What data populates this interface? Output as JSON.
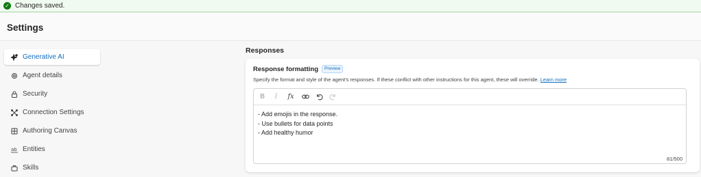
{
  "banner": {
    "message": "Changes saved."
  },
  "header": {
    "title": "Settings"
  },
  "sidebar": {
    "items": [
      {
        "label": "Generative AI"
      },
      {
        "label": "Agent details"
      },
      {
        "label": "Security"
      },
      {
        "label": "Connection Settings"
      },
      {
        "label": "Authoring Canvas"
      },
      {
        "label": "Entities"
      },
      {
        "label": "Skills"
      }
    ]
  },
  "main": {
    "section_title": "Responses",
    "card": {
      "title": "Response formatting",
      "badge": "Preview",
      "description": "Specify the format and style of the agent's responses. If these conflict with other instructions for this agent, these will override.",
      "learn_more": "Learn more",
      "editor": {
        "lines": [
          "- Add emojis in the response.",
          "- Use bullets for data points",
          "- Add healthy humor"
        ],
        "counter": "81/500"
      }
    }
  }
}
